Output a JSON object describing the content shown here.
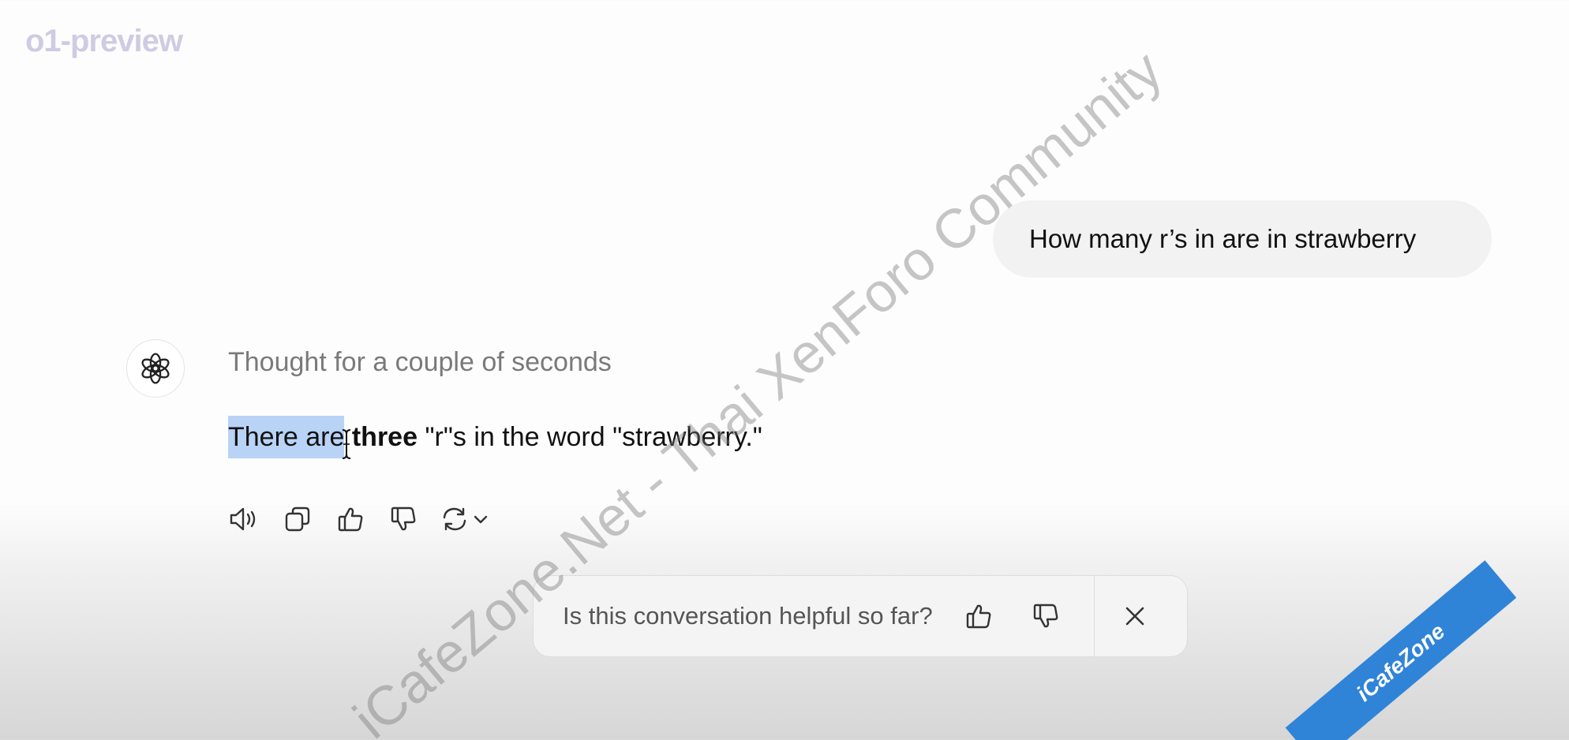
{
  "header": {
    "model_name": "o1-preview"
  },
  "conversation": {
    "user_message": "How many r’s in are in strawberry",
    "assistant": {
      "thought_label": "Thought for a couple of seconds",
      "answer": {
        "selected_text": "There are",
        "space_text": " ",
        "bold_text": "three",
        "rest_text": " \"r\"s in the word \"strawberry.\""
      }
    }
  },
  "message_actions": {
    "icons": [
      "read-aloud-icon",
      "copy-icon",
      "thumbs-up-icon",
      "thumbs-down-icon",
      "regenerate-icon",
      "chevron-down-icon"
    ]
  },
  "feedback": {
    "question": "Is this conversation helpful so far?",
    "icons": [
      "thumbs-up-icon",
      "thumbs-down-icon",
      "close-icon"
    ]
  },
  "watermark": {
    "text": "iCafeZone.Net - Thai XenForo Community",
    "corner_text": "iCafeZone"
  },
  "colors": {
    "model_name": "#cfcbe2",
    "selection": "#b8d3f5",
    "bubble": "#f2f2f2",
    "ribbon": "#2f84d8"
  }
}
